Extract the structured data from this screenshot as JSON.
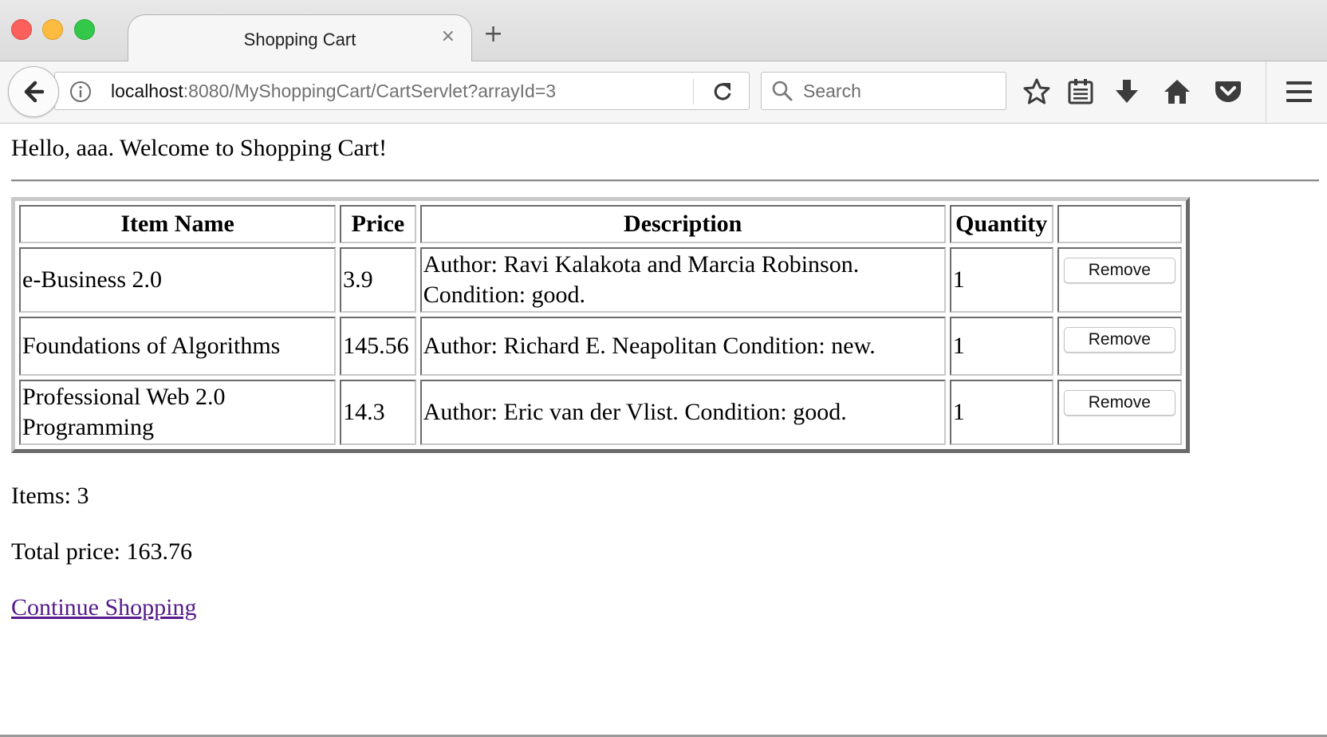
{
  "browser": {
    "tab_title": "Shopping Cart",
    "tab_close": "×",
    "new_tab": "+",
    "url_host": "localhost",
    "url_rest": ":8080/MyShoppingCart/CartServlet?arrayId=3",
    "search_placeholder": "Search",
    "icons": [
      "back-icon",
      "info-icon",
      "reload-icon",
      "search-icon",
      "bookmark-star-icon",
      "reading-list-icon",
      "download-icon",
      "home-icon",
      "pocket-icon",
      "menu-icon"
    ]
  },
  "page": {
    "greeting": "Hello, aaa. Welcome to Shopping Cart!",
    "table": {
      "headers": [
        "Item Name",
        "Price",
        "Description",
        "Quantity",
        ""
      ],
      "rows": [
        {
          "name": "e-Business 2.0",
          "price": "3.9",
          "description": "Author: Ravi Kalakota and Marcia Robinson. Condition: good.",
          "quantity": "1",
          "action": "Remove"
        },
        {
          "name": "Foundations of Algorithms",
          "price": "145.56",
          "description": "Author: Richard E. Neapolitan Condition: new.",
          "quantity": "1",
          "action": "Remove"
        },
        {
          "name": "Professional Web 2.0 Programming",
          "price": "14.3",
          "description": "Author: Eric van der Vlist. Condition: good.",
          "quantity": "1",
          "action": "Remove"
        }
      ]
    },
    "items_text": "Items: 3",
    "total_text": "Total price: 163.76",
    "continue_link": "Continue Shopping"
  },
  "colors": {
    "visited_link": "#551a8b",
    "traffic_red": "#fc605c",
    "traffic_yellow": "#fdbc40",
    "traffic_green": "#34c84a"
  }
}
